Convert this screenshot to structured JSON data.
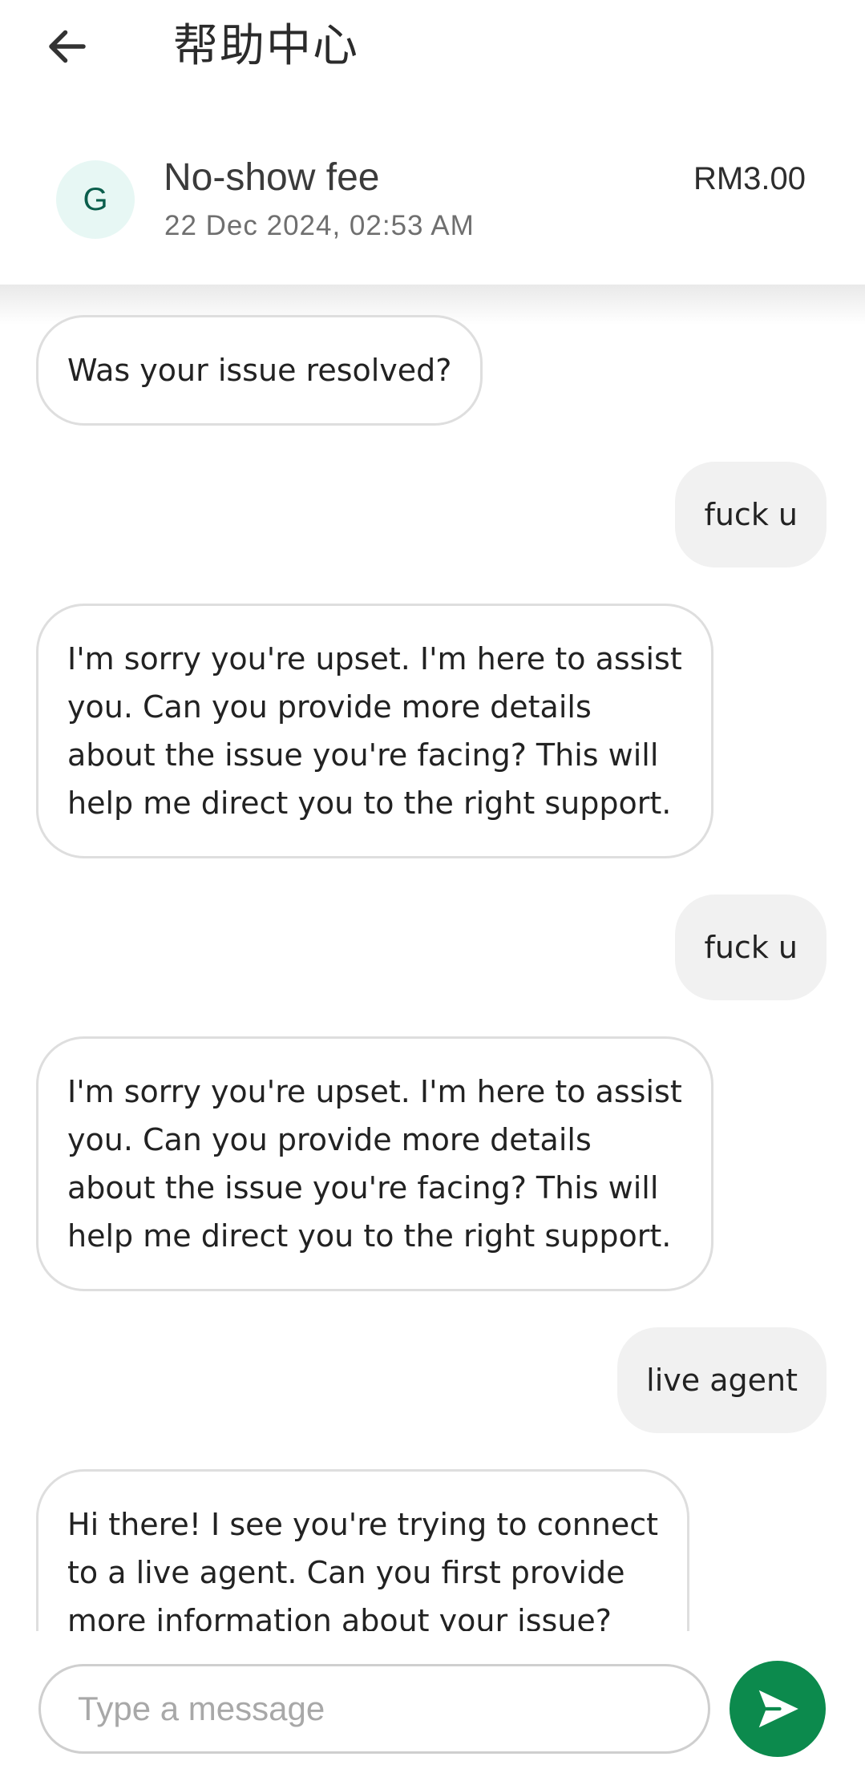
{
  "colors": {
    "accent": "#0c8a4d",
    "avatar_bg": "#e7f7f4",
    "user_bubble_bg": "#f1f1f1",
    "bot_bubble_border": "#dedede"
  },
  "header": {
    "back_icon": "arrow-left-icon",
    "title": "帮助中心"
  },
  "transaction": {
    "avatar_letter": "G",
    "title": "No-show fee",
    "date": "22 Dec 2024, 02:53 AM",
    "amount": "RM3.00"
  },
  "messages": [
    {
      "sender": "bot",
      "text": "Was your issue resolved?"
    },
    {
      "sender": "user",
      "text": "fuck u"
    },
    {
      "sender": "bot",
      "text": "I'm sorry you're upset. I'm here to assist\nyou. Can you provide more details\nabout the issue you're facing? This will\nhelp me direct you to the right support."
    },
    {
      "sender": "user",
      "text": "fuck u"
    },
    {
      "sender": "bot",
      "text": "I'm sorry you're upset. I'm here to assist\nyou. Can you provide more details\nabout the issue you're facing? This will\nhelp me direct you to the right support."
    },
    {
      "sender": "user",
      "text": "live agent"
    },
    {
      "sender": "bot",
      "text": "Hi there! I see you're trying to connect\nto a live agent. Can you first provide\nmore information about your issue?"
    }
  ],
  "composer": {
    "placeholder": "Type a message",
    "value": "",
    "send_icon": "send-icon"
  }
}
